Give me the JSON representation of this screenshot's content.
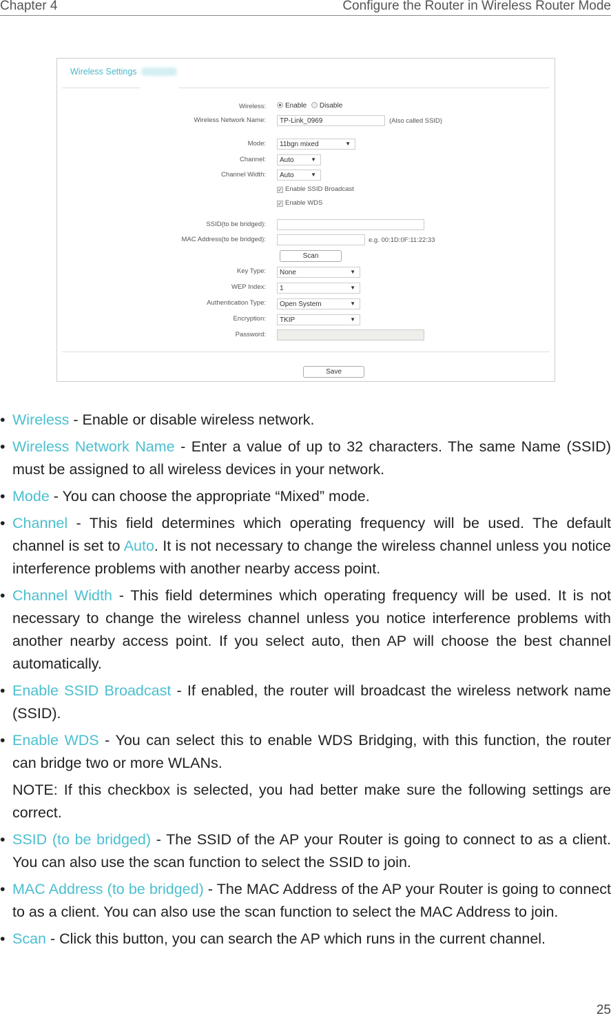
{
  "header": {
    "chapter": "Chapter 4",
    "section": "Configure the Router in Wireless Router Mode"
  },
  "form": {
    "title": "Wireless Settings",
    "wireless_label": "Wireless:",
    "enable": "Enable",
    "disable": "Disable",
    "wireless_value": "Enable",
    "name_label": "Wireless Network Name:",
    "name_value": "TP-Link_0969",
    "name_hint": "(Also called SSID)",
    "mode_label": "Mode:",
    "mode_value": "11bgn mixed",
    "channel_label": "Channel:",
    "channel_value": "Auto",
    "width_label": "Channel Width:",
    "width_value": "Auto",
    "ssid_broadcast": "Enable SSID Broadcast",
    "ssid_broadcast_checked": true,
    "wds": "Enable WDS",
    "wds_checked": true,
    "ssid_bridged_label": "SSID(to be bridged):",
    "ssid_bridged_value": "",
    "mac_label": "MAC Address(to be bridged):",
    "mac_value": "",
    "mac_hint": "e.g. 00:1D:0F:11:22:33",
    "scan": "Scan",
    "key_type_label": "Key Type:",
    "key_type_value": "None",
    "wep_label": "WEP Index:",
    "wep_value": "1",
    "auth_label": "Authentication Type:",
    "auth_value": "Open System",
    "enc_label": "Encryption:",
    "enc_value": "TKIP",
    "password_label": "Password:",
    "password_value": "",
    "save": "Save"
  },
  "bullets": [
    {
      "term": "Wireless",
      "text": " - Enable or disable wireless network."
    },
    {
      "term": "Wireless Network Name",
      "text": " -  Enter a value of up to 32 characters. The same Name (SSID) must be assigned to all wireless devices in your network."
    },
    {
      "term": "Mode",
      "text": " - You can choose the appropriate “Mixed” mode."
    },
    {
      "term": "Channel",
      "text": " - This field determines which operating frequency will be used. The default channel is set to ",
      "term2": "Auto",
      "text2": ". It is not necessary to change the wireless channel unless you notice interference problems with another nearby access point."
    },
    {
      "term": "Channel Width",
      "text": " - This field determines which operating frequency will be used. It is not necessary to change the wireless channel unless you notice interference problems with another nearby access point. If you select auto, then AP will choose the best channel automatically."
    },
    {
      "term": "Enable SSID Broadcast",
      "text": " - If enabled, the router will broadcast the wireless network name (SSID)."
    },
    {
      "term": "Enable WDS",
      "text": " - You can select this to enable WDS Bridging, with this function, the router can bridge two or more WLANs."
    },
    {
      "term": "SSID (to be bridged)",
      "text": " - The SSID of the AP your Router is going to connect to as a client. You can also use the scan function to select the SSID to join."
    },
    {
      "term": "MAC Address (to be bridged)",
      "text": " - The MAC Address of the AP your Router is going to connect to as a client. You can also use the scan function to select the MAC Address to join."
    },
    {
      "term": "Scan",
      "text": " - Click this button, you can search the AP which runs in the current channel."
    }
  ],
  "note": "NOTE: If this checkbox is selected, you had better make sure the following settings are correct.",
  "page_number": "25",
  "colors": {
    "accent": "#4bbfcf"
  }
}
